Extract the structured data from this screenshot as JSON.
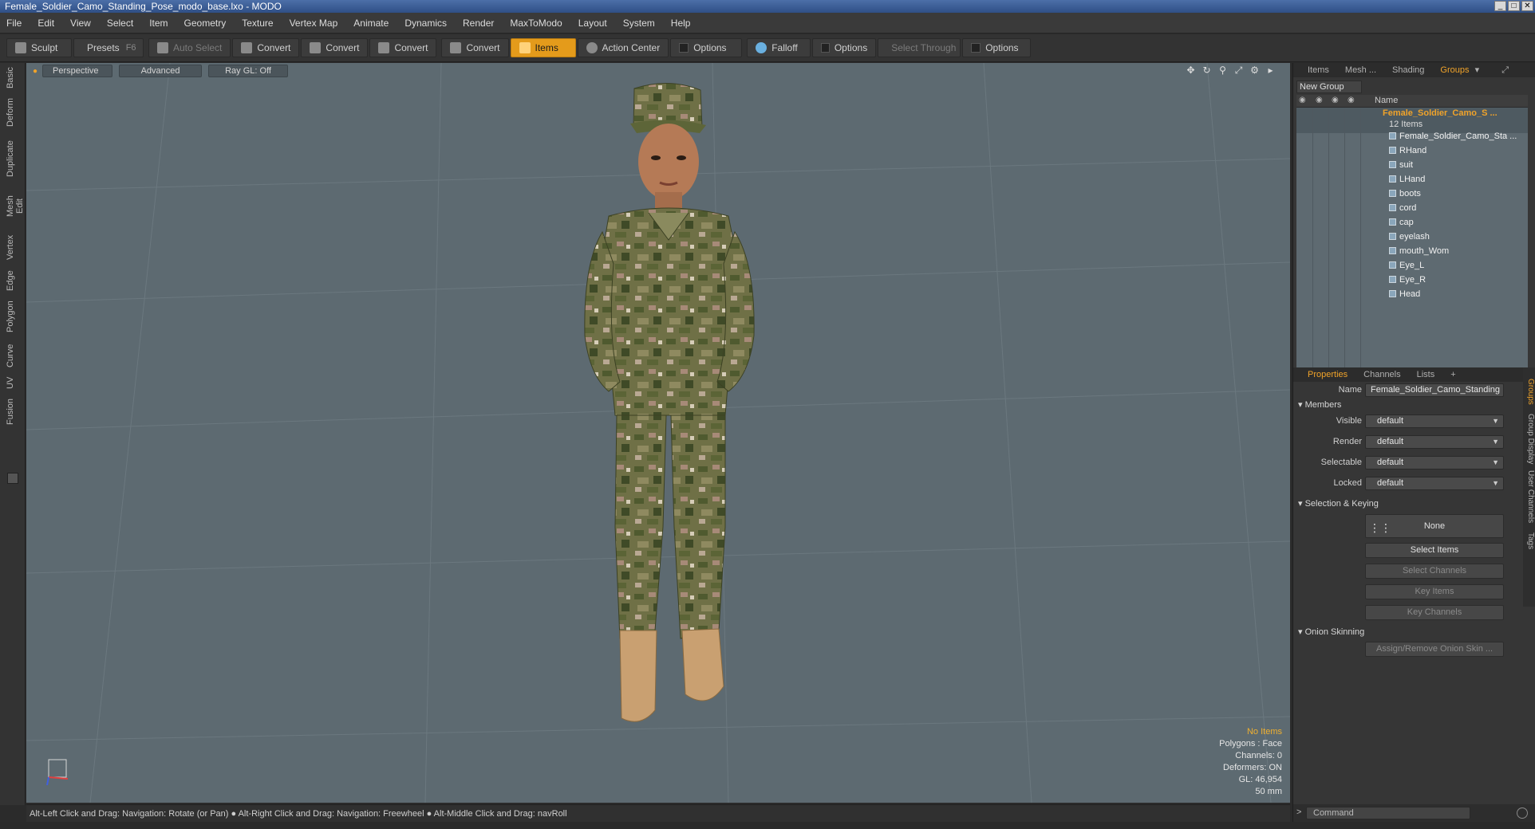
{
  "window": {
    "title": "Female_Soldier_Camo_Standing_Pose_modo_base.lxo - MODO"
  },
  "menu": [
    "File",
    "Edit",
    "View",
    "Select",
    "Item",
    "Geometry",
    "Texture",
    "Vertex Map",
    "Animate",
    "Dynamics",
    "Render",
    "MaxToModo",
    "Layout",
    "System",
    "Help"
  ],
  "toolbar": {
    "sculpt": "Sculpt",
    "presets": "Presets",
    "presets_key": "F6",
    "auto_select": "Auto Select",
    "convert1": "Convert",
    "convert2": "Convert",
    "convert3": "Convert",
    "convert4": "Convert",
    "items": "Items",
    "action_center": "Action Center",
    "options1": "Options",
    "falloff": "Falloff",
    "options2": "Options",
    "select_through": "Select Through",
    "options3": "Options"
  },
  "left_tabs": [
    "Basic",
    "Deform",
    "Duplicate",
    "Mesh Edit",
    "Vertex",
    "Edge",
    "Polygon",
    "Curve",
    "UV",
    "Fusion"
  ],
  "viewport": {
    "perspective": "Perspective",
    "advanced": "Advanced",
    "raygl": "Ray GL: Off",
    "info": {
      "no_items": "No Items",
      "polygons": "Polygons : Face",
      "channels": "Channels: 0",
      "deformers": "Deformers: ON",
      "gl": "GL: 46,954",
      "lens": "50 mm"
    }
  },
  "status": "Alt-Left Click and Drag: Navigation: Rotate (or Pan) ● Alt-Right Click and Drag: Navigation: Freewheel ● Alt-Middle Click and Drag: navRoll",
  "panel": {
    "tabs": [
      "Items",
      "Mesh ...",
      "Shading",
      "Groups"
    ],
    "new_group": "New Group",
    "name_col": "Name",
    "group_name": "Female_Soldier_Camo_S ...",
    "group_count": "12 Items",
    "items": [
      "Female_Soldier_Camo_Sta ...",
      "RHand",
      "suit",
      "LHand",
      "boots",
      "cord",
      "cap",
      "eyelash",
      "mouth_Wom",
      "Eye_L",
      "Eye_R",
      "Head"
    ]
  },
  "props": {
    "tabs": [
      "Properties",
      "Channels",
      "Lists"
    ],
    "plus": "+",
    "name_label": "Name",
    "name_value": "Female_Soldier_Camo_Standing",
    "members": "Members",
    "visible_label": "Visible",
    "visible": "default",
    "render_label": "Render",
    "render": "default",
    "selectable_label": "Selectable",
    "selectable": "default",
    "locked_label": "Locked",
    "locked": "default",
    "sel_keying": "Selection & Keying",
    "none": "None",
    "select_items": "Select Items",
    "select_channels": "Select Channels",
    "key_items": "Key Items",
    "key_channels": "Key Channels",
    "onion": "Onion Skinning",
    "assign_onion": "Assign/Remove Onion Skin ...",
    "side_tabs": [
      "Groups",
      "Group Display",
      "User Channels",
      "Tags"
    ]
  },
  "command": {
    "prompt": ">",
    "placeholder": "Command"
  },
  "colors": {
    "accent": "#e49b1b",
    "viewport": "#5d6a71",
    "highlight_text": "#f0a32a"
  }
}
